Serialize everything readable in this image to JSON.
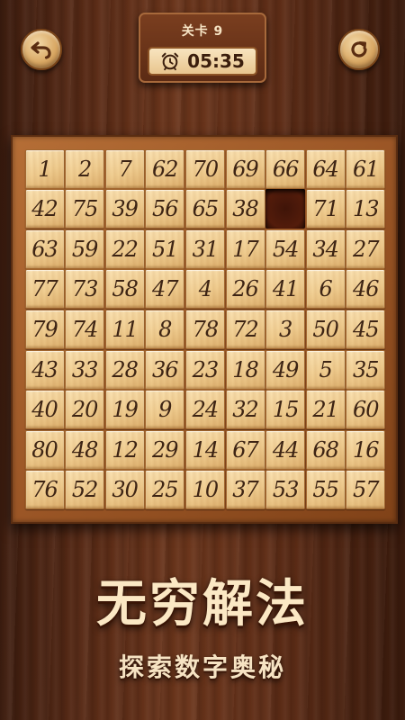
{
  "header": {
    "level_label": "关卡 9",
    "timer": "05:35",
    "back_icon": "undo-arrow-icon",
    "restart_icon": "refresh-icon",
    "timer_icon": "alarm-clock-icon"
  },
  "board": {
    "rows": 9,
    "cols": 9,
    "empty_cell": [
      1,
      6
    ],
    "tiles": [
      [
        "1",
        "2",
        "7",
        "62",
        "70",
        "69",
        "66",
        "64",
        "61"
      ],
      [
        "42",
        "75",
        "39",
        "56",
        "65",
        "38",
        "",
        "71",
        "13"
      ],
      [
        "63",
        "59",
        "22",
        "51",
        "31",
        "17",
        "54",
        "34",
        "27"
      ],
      [
        "77",
        "73",
        "58",
        "47",
        "4",
        "26",
        "41",
        "6",
        "46"
      ],
      [
        "79",
        "74",
        "11",
        "8",
        "78",
        "72",
        "3",
        "50",
        "45"
      ],
      [
        "43",
        "33",
        "28",
        "36",
        "23",
        "18",
        "49",
        "5",
        "35"
      ],
      [
        "40",
        "20",
        "19",
        "9",
        "24",
        "32",
        "15",
        "21",
        "60"
      ],
      [
        "80",
        "48",
        "12",
        "29",
        "14",
        "67",
        "44",
        "68",
        "16"
      ],
      [
        "76",
        "52",
        "30",
        "25",
        "10",
        "37",
        "53",
        "55",
        "57"
      ]
    ]
  },
  "promo": {
    "title": "无穷解法",
    "subtitle": "探索数字奥秘"
  },
  "colors": {
    "tile": "#f0cd90",
    "tile_text": "#3d2414",
    "board_frame": "#9b5626",
    "empty_slot": "#531c0b"
  }
}
